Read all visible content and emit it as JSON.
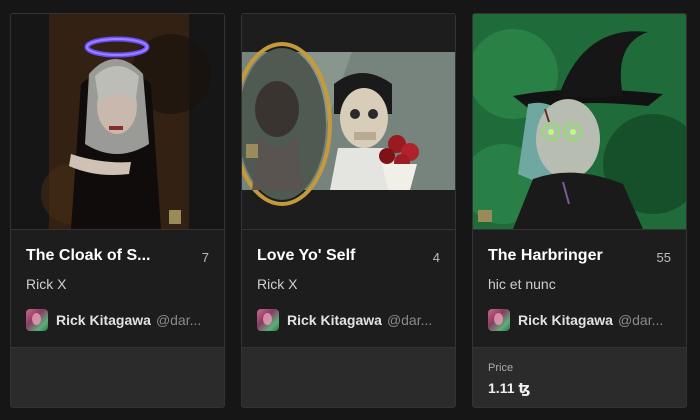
{
  "cards": [
    {
      "title": "The Cloak of S...",
      "count": "7",
      "collection": "Rick X",
      "creator_name": "Rick Kitagawa",
      "creator_handle": "@dar...",
      "image_icon": "dark-portrait-halo-artwork"
    },
    {
      "title": "Love Yo' Self",
      "count": "4",
      "collection": "Rick X",
      "creator_name": "Rick Kitagawa",
      "creator_handle": "@dar...",
      "image_icon": "mirror-skull-artwork"
    },
    {
      "title": "The Harbringer",
      "count": "55",
      "collection": "hic et nunc",
      "creator_name": "Rick Kitagawa",
      "creator_handle": "@dar...",
      "image_icon": "witch-portrait-artwork",
      "price_label": "Price",
      "price_value": "1.11 ꜩ"
    }
  ],
  "colors": {
    "background": "#161616",
    "card": "#1d1d1d",
    "footer": "#2b2b2b",
    "border": "#333333"
  }
}
